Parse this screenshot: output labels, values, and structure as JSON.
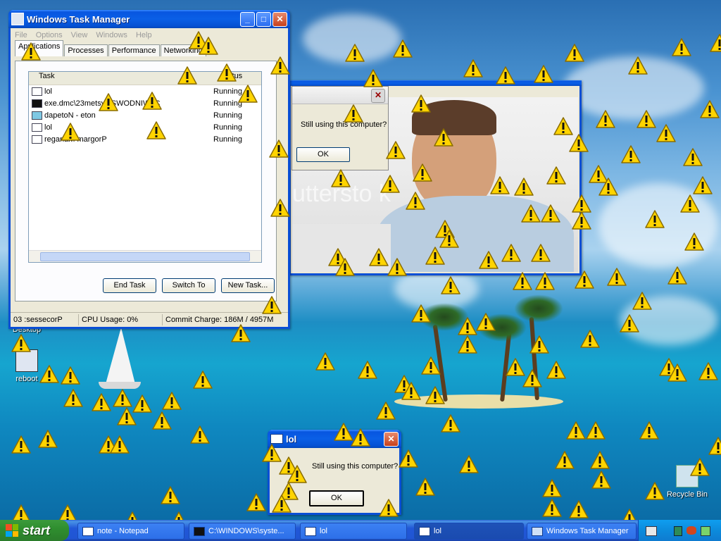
{
  "desktop": {
    "icons": [
      {
        "label": "Desktop"
      },
      {
        "label": "reboot"
      },
      {
        "label": "Recycle Bin"
      }
    ]
  },
  "task_manager": {
    "title": "Windows Task Manager",
    "menu": [
      "File",
      "Options",
      "View",
      "Windows",
      "Help"
    ],
    "tabs": [
      "Applications",
      "Processes",
      "Performance",
      "Networking"
    ],
    "columns": {
      "task": "Task",
      "status": "Status"
    },
    "rows": [
      {
        "task": "lol",
        "status": "Running",
        "icon": "window-icon"
      },
      {
        "task": "exe.dmc\\23metsys\\SWODNIW\\:C",
        "status": "Running",
        "icon": "cmd-icon"
      },
      {
        "task": "dapetoN - eton",
        "status": "Running",
        "icon": "notepad-icon"
      },
      {
        "task": "lol",
        "status": "Running",
        "icon": "window-icon"
      },
      {
        "task": "reganaM margorP",
        "status": "Running",
        "icon": "window-icon"
      }
    ],
    "buttons": {
      "end_task": "End Task",
      "switch_to": "Switch To",
      "new_task": "New Task..."
    },
    "status": {
      "processes": "03 :sessecorP",
      "cpu": "CPU Usage: 0%",
      "commit": "Commit Charge: 186M / 4957M"
    }
  },
  "photo_window": {
    "watermark": "uttersto k"
  },
  "dialog_back": {
    "message": "Still using this computer?",
    "ok_label": "OK"
  },
  "dialog_front": {
    "title": "lol",
    "message": "Still using this computer?",
    "ok_label": "OK"
  },
  "taskbar": {
    "start_label": "start",
    "items": [
      {
        "label": "note - Notepad",
        "active": false
      },
      {
        "label": "C:\\WINDOWS\\syste...",
        "active": false
      },
      {
        "label": "lol",
        "active": false
      },
      {
        "label": "lol",
        "active": true
      },
      {
        "label": "Windows Task Manager",
        "active": false
      }
    ]
  },
  "colors": {
    "xp_blue": "#0a5fe6",
    "warning_yellow": "#ffd400",
    "start_green": "#2f8f2f"
  }
}
